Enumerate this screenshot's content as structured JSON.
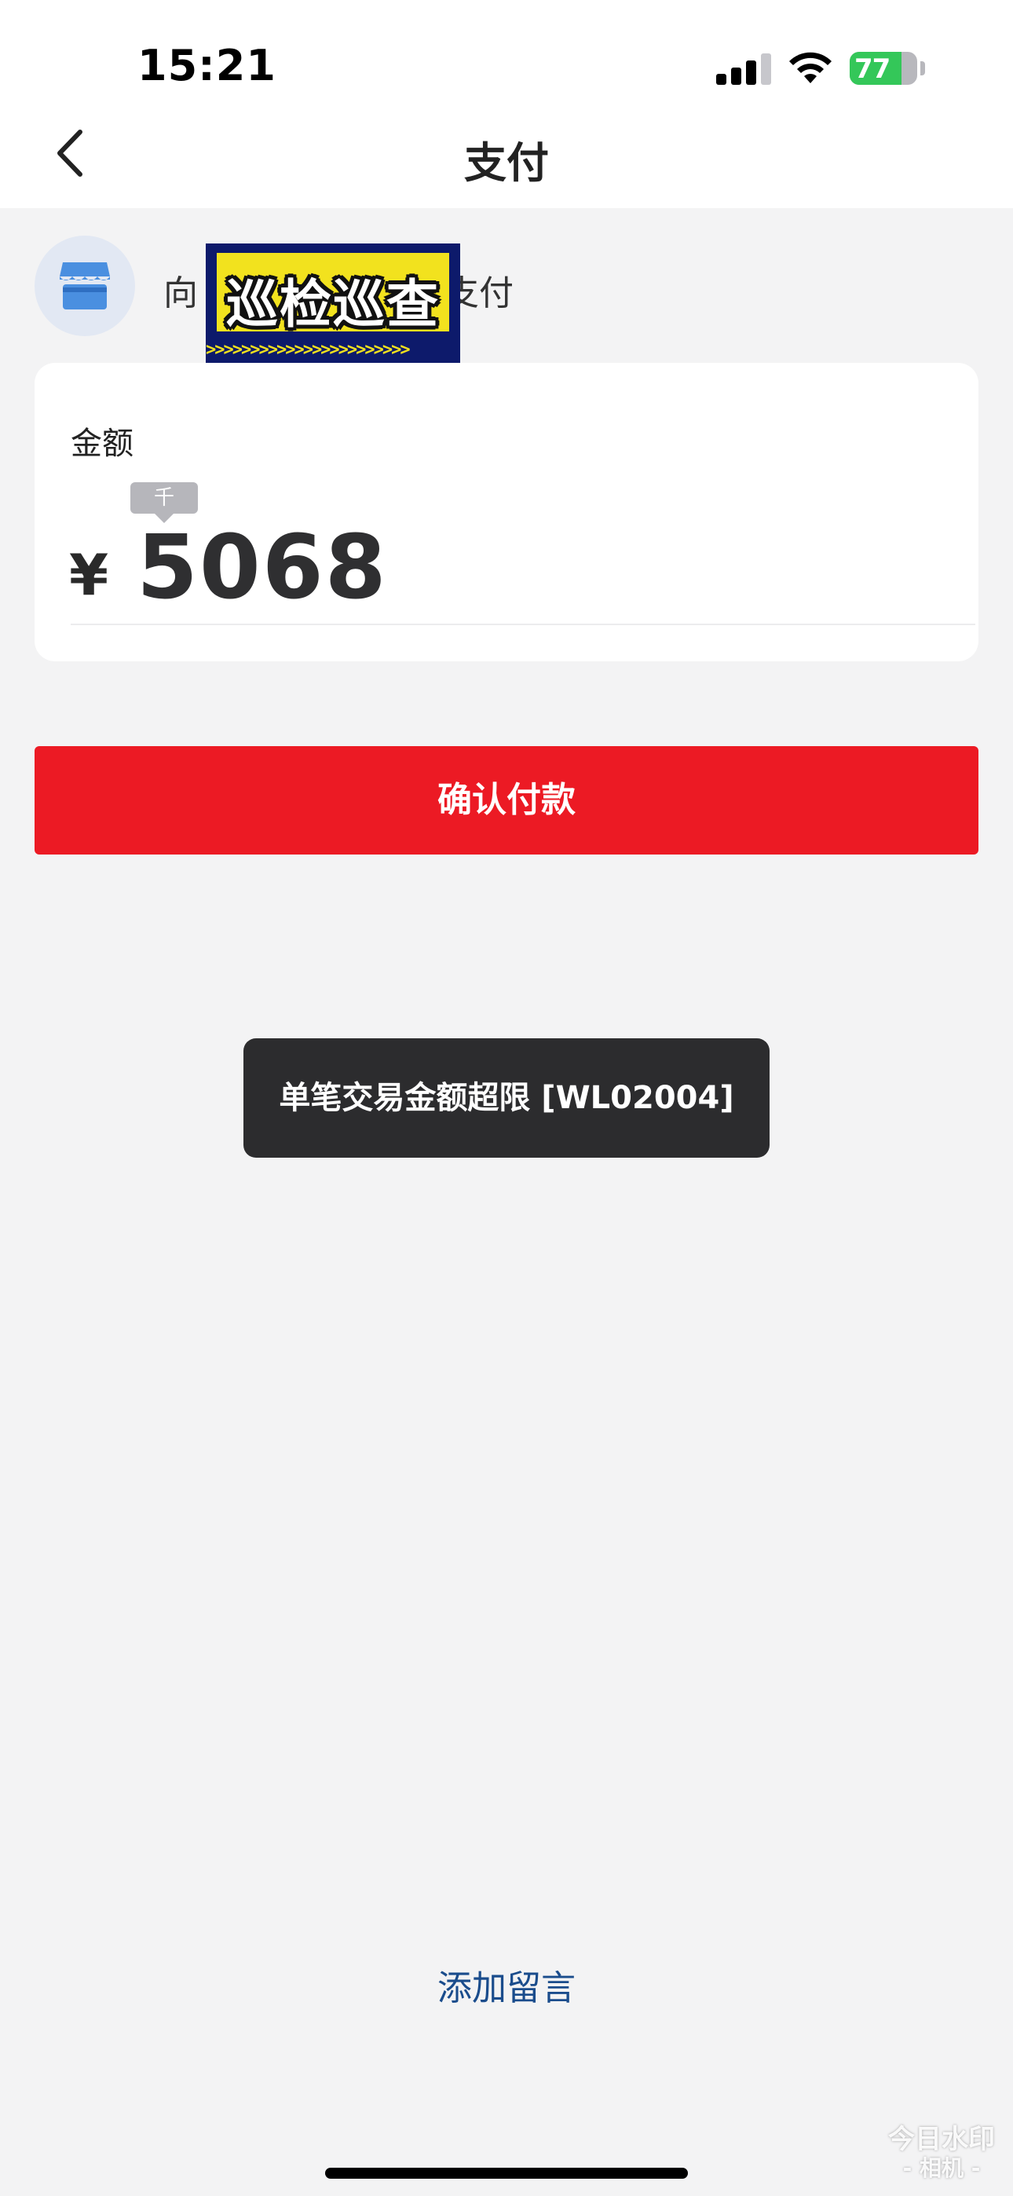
{
  "status_bar": {
    "time": "15:21",
    "battery": "77",
    "battery_level": 0.77,
    "colors": {
      "battery": "#34c759"
    }
  },
  "nav": {
    "back_icon": "chevron-left-icon",
    "title": "支付"
  },
  "merchant": {
    "icon": "storefront-icon",
    "prefix": "向",
    "suffix": "支付",
    "sticker_text": "巡检巡查",
    "sticker_chevrons": ">>>>>>>>>>>>>>>>>>>>>>>"
  },
  "amount": {
    "label": "金额",
    "unit_hint": "千",
    "currency": "¥",
    "value": "5068"
  },
  "confirm": {
    "label": "确认付款",
    "color": "#ec1a24"
  },
  "toast": {
    "message": "单笔交易金额超限 [WL02004]"
  },
  "footer": {
    "add_note": "添加留言"
  },
  "watermark": {
    "line1": "今日水印",
    "line2": "- 相机 -"
  }
}
